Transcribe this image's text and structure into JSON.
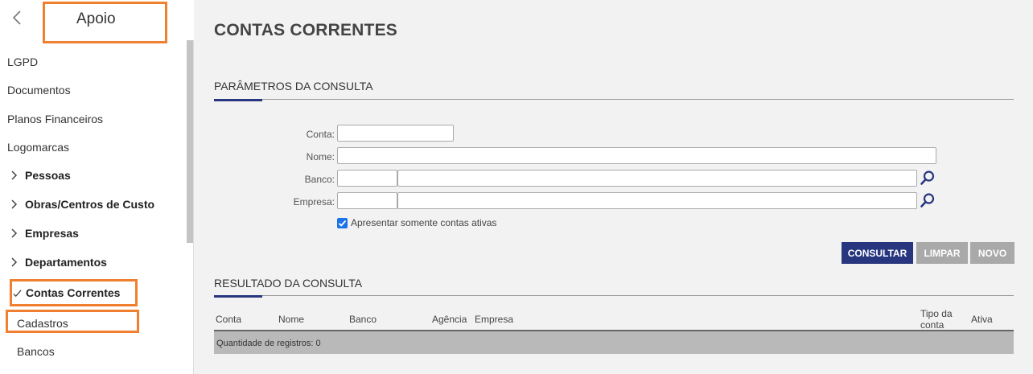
{
  "sidebar": {
    "title": "Apoio",
    "items": [
      {
        "label": "LGPD"
      },
      {
        "label": "Documentos"
      },
      {
        "label": "Planos Financeiros"
      },
      {
        "label": "Logomarcas"
      },
      {
        "label": "Pessoas"
      },
      {
        "label": "Obras/Centros de Custo"
      },
      {
        "label": "Empresas"
      },
      {
        "label": "Departamentos"
      },
      {
        "label": "Contas Correntes"
      },
      {
        "label": "Cadastros"
      },
      {
        "label": "Bancos"
      }
    ]
  },
  "main": {
    "page_title": "CONTAS CORRENTES",
    "params_title": "PARÂMETROS DA CONSULTA",
    "fields": {
      "conta": {
        "label": "Conta:",
        "value": ""
      },
      "nome": {
        "label": "Nome:",
        "value": ""
      },
      "banco": {
        "label": "Banco:",
        "code": "",
        "name": ""
      },
      "empresa": {
        "label": "Empresa:",
        "code": "",
        "name": ""
      }
    },
    "checkbox": {
      "label": "Apresentar somente contas ativas",
      "checked": true
    },
    "buttons": {
      "consultar": "CONSULTAR",
      "limpar": "LIMPAR",
      "novo": "NOVO"
    },
    "results_title": "RESULTADO DA CONSULTA",
    "columns": {
      "conta": "Conta",
      "nome": "Nome",
      "banco": "Banco",
      "agencia": "Agência",
      "empresa": "Empresa",
      "tipo1": "Tipo da",
      "tipo2": "conta",
      "ativa": "Ativa"
    },
    "footer": "Quantidade de registros: 0"
  },
  "colors": {
    "primary": "#27367e",
    "highlight": "#f08030",
    "button_disabled": "#a9a9a9",
    "checkbox": "#1a73e8"
  },
  "icons": {
    "back": "chevron-left-icon",
    "expand": "chevron-right-icon",
    "expanded": "check-icon",
    "lookup": "search-icon"
  }
}
